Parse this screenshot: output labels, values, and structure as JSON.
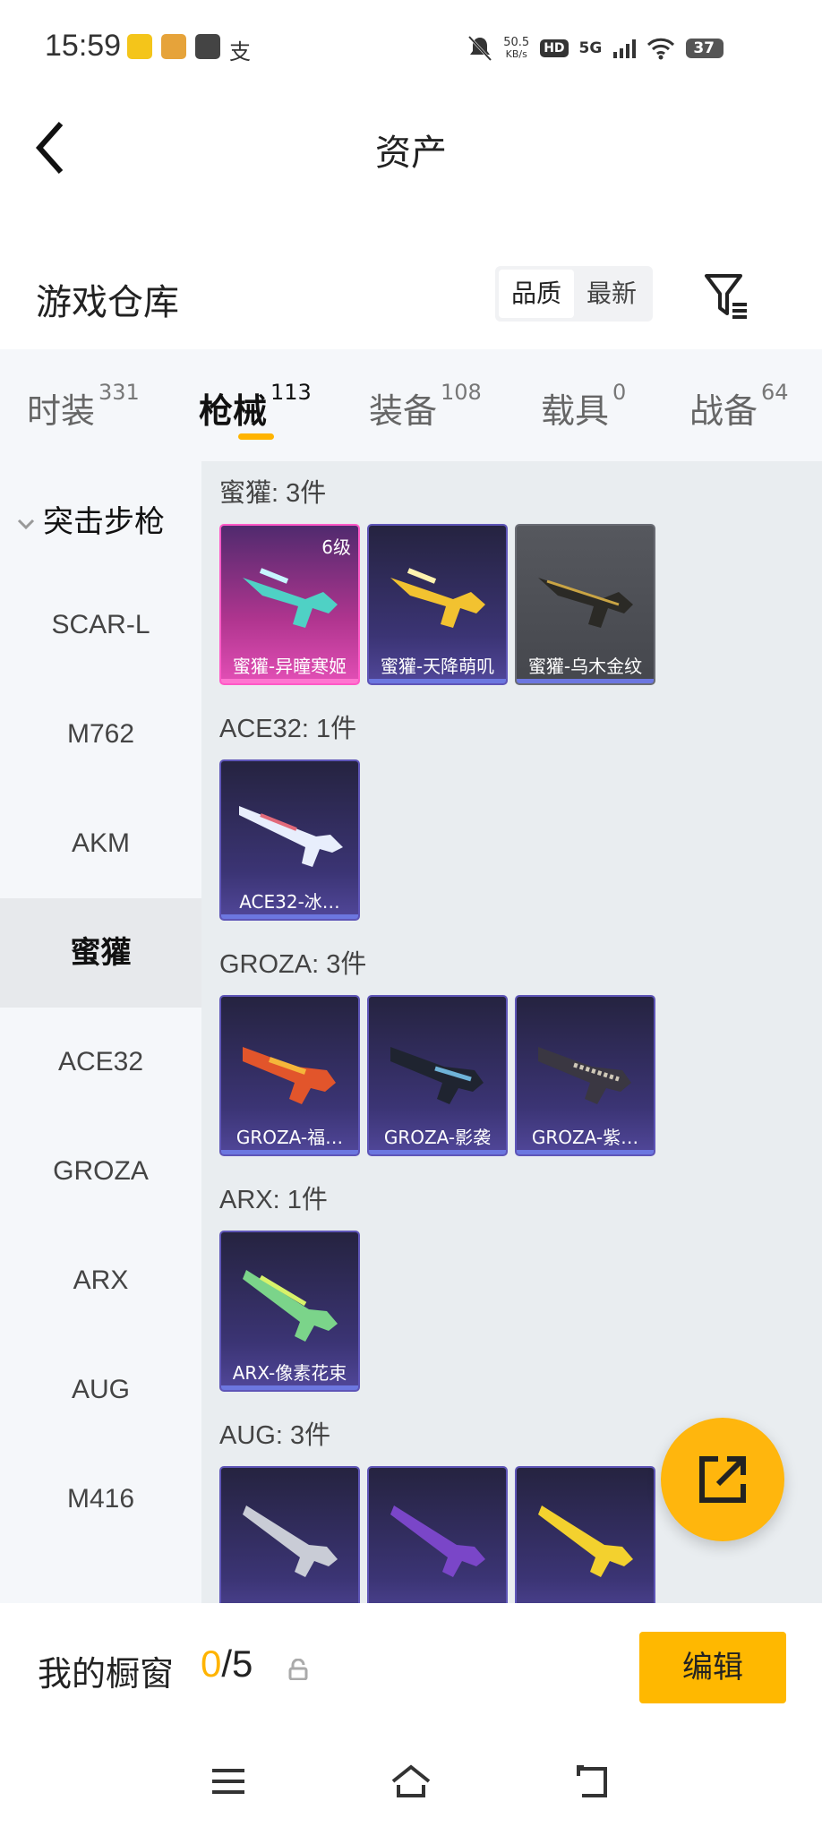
{
  "status_bar": {
    "time": "15:59",
    "net_speed_value": "50.5",
    "net_speed_unit": "KB/s",
    "hd": "HD",
    "network": "5G",
    "battery": "37"
  },
  "header": {
    "title": "资产"
  },
  "warehouse": {
    "title": "游戏仓库",
    "sort_options": [
      "品质",
      "最新"
    ],
    "active_sort": "品质"
  },
  "tabs": [
    {
      "label": "时装",
      "count": "331"
    },
    {
      "label": "枪械",
      "count": "113"
    },
    {
      "label": "装备",
      "count": "108"
    },
    {
      "label": "载具",
      "count": "0"
    },
    {
      "label": "战备",
      "count": "64"
    }
  ],
  "active_tab": "枪械",
  "sidebar": {
    "category": "突击步枪",
    "items": [
      "SCAR-L",
      "M762",
      "AKM",
      "蜜獾",
      "ACE32",
      "GROZA",
      "ARX",
      "AUG",
      "M416"
    ],
    "active_item": "蜜獾"
  },
  "groups": [
    {
      "title": "蜜獾: 3件",
      "items": [
        {
          "name": "蜜獾-异瞳寒姬",
          "level": "6级",
          "rarity": "pink"
        },
        {
          "name": "蜜獾-天降萌叽",
          "rarity": "purple"
        },
        {
          "name": "蜜獾-乌木金纹",
          "rarity": "gray"
        }
      ]
    },
    {
      "title": "ACE32: 1件",
      "items": [
        {
          "name": "ACE32-冰…",
          "rarity": "purple"
        }
      ]
    },
    {
      "title": "GROZA: 3件",
      "items": [
        {
          "name": "GROZA-福…",
          "rarity": "purple"
        },
        {
          "name": "GROZA-影袭",
          "rarity": "purple"
        },
        {
          "name": "GROZA-紫…",
          "rarity": "purple"
        }
      ]
    },
    {
      "title": "ARX: 1件",
      "items": [
        {
          "name": "ARX-像素花束",
          "rarity": "purple"
        }
      ]
    },
    {
      "title": "AUG: 3件",
      "items": [
        {
          "name": "",
          "rarity": "purple"
        },
        {
          "name": "",
          "rarity": "purple"
        },
        {
          "name": "",
          "rarity": "purple"
        }
      ]
    }
  ],
  "showcase": {
    "label": "我的橱窗",
    "count": "0",
    "total": "/5",
    "edit_label": "编辑"
  },
  "colors": {
    "accent": "#ffb400",
    "rarity_pink": "#e34fb6",
    "rarity_purple": "#5e55b7",
    "rarity_gray": "#6a6c74"
  },
  "icons": {
    "back": "back-arrow-icon",
    "filter": "filter-icon",
    "fab": "share-export-icon",
    "lock": "lock-icon",
    "nav": [
      "menu-icon",
      "home-icon",
      "back-icon"
    ]
  }
}
